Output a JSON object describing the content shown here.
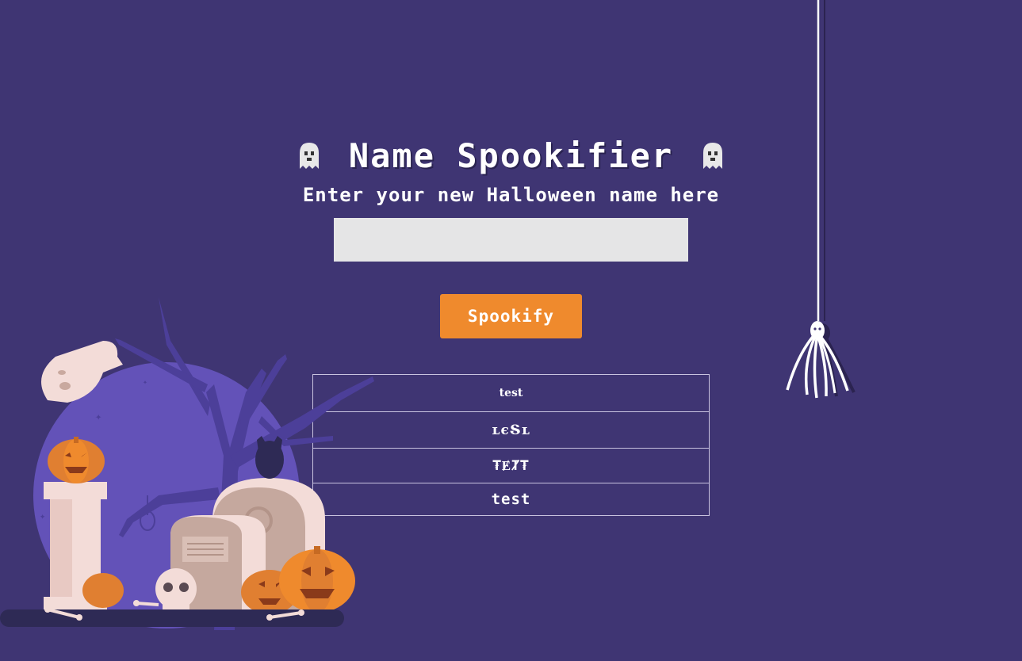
{
  "header": {
    "title": "Name Spookifier",
    "left_icon": "ghost-icon",
    "right_icon": "ghost-icon"
  },
  "form": {
    "subtitle": "Enter your new Halloween name here",
    "name_input_value": "",
    "submit_label": "Spookify"
  },
  "results": [
    {
      "text": "test"
    },
    {
      "text": "ʟєՏʟ"
    },
    {
      "text": "₮ɆȾ₮"
    },
    {
      "text": "test"
    }
  ],
  "decorations": {
    "spider_icon": "spider-icon",
    "scene": "graveyard-illustration"
  },
  "colors": {
    "background": "#3f3573",
    "accent": "#ef8a2d",
    "input_bg": "#e5e5e6",
    "table_border": "#c9c3e0"
  }
}
